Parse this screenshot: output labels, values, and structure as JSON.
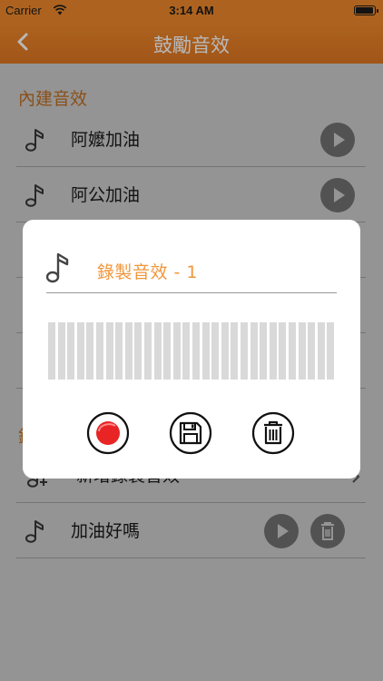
{
  "status_bar": {
    "carrier": "Carrier",
    "time": "3:14 AM"
  },
  "nav": {
    "title": "鼓勵音效",
    "back_icon": "chevron-left-icon"
  },
  "builtin_section": {
    "header": "內建音效",
    "items": [
      {
        "label": "阿嬤加油"
      },
      {
        "label": "阿公加油"
      }
    ]
  },
  "recorded_section": {
    "header_char": "錄",
    "add_label": "新增錄製音效",
    "items": [
      {
        "label": "加油好嗎"
      }
    ]
  },
  "modal": {
    "name": "錄製音效 - 1",
    "waveform_bar_count": 30,
    "controls": [
      "record-icon",
      "save-icon",
      "trash-icon"
    ]
  },
  "colors": {
    "accent": "#f08a2c",
    "accent_text": "#f0963a",
    "button_gray": "#8e8e8e",
    "record_red": "#e82424"
  }
}
